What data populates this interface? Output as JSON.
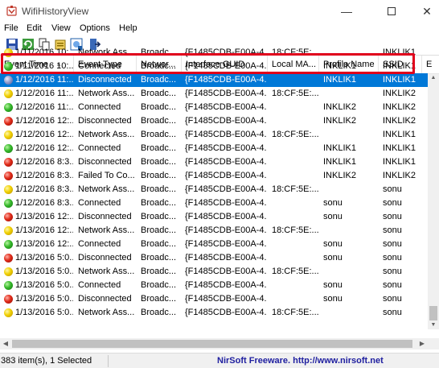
{
  "window": {
    "title": "WifiHistoryView"
  },
  "menu": [
    "File",
    "Edit",
    "View",
    "Options",
    "Help"
  ],
  "toolbar": [
    "save-icon",
    "refresh-icon",
    "copy-icon",
    "properties-icon",
    "html-report-icon",
    "exit-icon"
  ],
  "columns": [
    "Event Time",
    "Event Type",
    "Networ...",
    "Interface GUID",
    "Local MA...",
    "Profile Name",
    "SSID",
    "E"
  ],
  "rows": [
    {
      "status": "yellow",
      "time": "1/11/2016 10:...",
      "type": "Network Ass...",
      "network": "Broadc...",
      "guid": "{F1485CDB-E00A-4...",
      "mac": "18:CF:5E:...",
      "profile": "",
      "ssid": "INKLIK1"
    },
    {
      "status": "green",
      "time": "1/11/2016 10:...",
      "type": "Connected",
      "network": "Broadc...",
      "guid": "{F1485CDB-E00A-4...",
      "mac": "",
      "profile": "INKLIK1",
      "ssid": "INKLIK1"
    },
    {
      "status": "gray",
      "time": "1/12/2016 11:...",
      "type": "Disconnected",
      "network": "Broadc...",
      "guid": "{F1485CDB-E00A-4...",
      "mac": "",
      "profile": "INKLIK1",
      "ssid": "INKLIK1",
      "selected": true
    },
    {
      "status": "yellow",
      "time": "1/12/2016 11:...",
      "type": "Network Ass...",
      "network": "Broadc...",
      "guid": "{F1485CDB-E00A-4...",
      "mac": "18:CF:5E:...",
      "profile": "",
      "ssid": "INKLIK2"
    },
    {
      "status": "green",
      "time": "1/12/2016 11:...",
      "type": "Connected",
      "network": "Broadc...",
      "guid": "{F1485CDB-E00A-4...",
      "mac": "",
      "profile": "INKLIK2",
      "ssid": "INKLIK2"
    },
    {
      "status": "red",
      "time": "1/12/2016 12:...",
      "type": "Disconnected",
      "network": "Broadc...",
      "guid": "{F1485CDB-E00A-4...",
      "mac": "",
      "profile": "INKLIK2",
      "ssid": "INKLIK2"
    },
    {
      "status": "yellow",
      "time": "1/12/2016 12:...",
      "type": "Network Ass...",
      "network": "Broadc...",
      "guid": "{F1485CDB-E00A-4...",
      "mac": "18:CF:5E:...",
      "profile": "",
      "ssid": "INKLIK1"
    },
    {
      "status": "green",
      "time": "1/12/2016 12:...",
      "type": "Connected",
      "network": "Broadc...",
      "guid": "{F1485CDB-E00A-4...",
      "mac": "",
      "profile": "INKLIK1",
      "ssid": "INKLIK1"
    },
    {
      "status": "red",
      "time": "1/12/2016 8:3...",
      "type": "Disconnected",
      "network": "Broadc...",
      "guid": "{F1485CDB-E00A-4...",
      "mac": "",
      "profile": "INKLIK1",
      "ssid": "INKLIK1"
    },
    {
      "status": "red",
      "time": "1/12/2016 8:3...",
      "type": "Failed To Co...",
      "network": "Broadc...",
      "guid": "{F1485CDB-E00A-4...",
      "mac": "",
      "profile": "INKLIK2",
      "ssid": "INKLIK2"
    },
    {
      "status": "yellow",
      "time": "1/12/2016 8:3...",
      "type": "Network Ass...",
      "network": "Broadc...",
      "guid": "{F1485CDB-E00A-4...",
      "mac": "18:CF:5E:...",
      "profile": "",
      "ssid": "sonu"
    },
    {
      "status": "green",
      "time": "1/12/2016 8:3...",
      "type": "Connected",
      "network": "Broadc...",
      "guid": "{F1485CDB-E00A-4...",
      "mac": "",
      "profile": "sonu",
      "ssid": "sonu"
    },
    {
      "status": "red",
      "time": "1/13/2016 12:...",
      "type": "Disconnected",
      "network": "Broadc...",
      "guid": "{F1485CDB-E00A-4...",
      "mac": "",
      "profile": "sonu",
      "ssid": "sonu"
    },
    {
      "status": "yellow",
      "time": "1/13/2016 12:...",
      "type": "Network Ass...",
      "network": "Broadc...",
      "guid": "{F1485CDB-E00A-4...",
      "mac": "18:CF:5E:...",
      "profile": "",
      "ssid": "sonu"
    },
    {
      "status": "green",
      "time": "1/13/2016 12:...",
      "type": "Connected",
      "network": "Broadc...",
      "guid": "{F1485CDB-E00A-4...",
      "mac": "",
      "profile": "sonu",
      "ssid": "sonu"
    },
    {
      "status": "red",
      "time": "1/13/2016 5:0...",
      "type": "Disconnected",
      "network": "Broadc...",
      "guid": "{F1485CDB-E00A-4...",
      "mac": "",
      "profile": "sonu",
      "ssid": "sonu"
    },
    {
      "status": "yellow",
      "time": "1/13/2016 5:0...",
      "type": "Network Ass...",
      "network": "Broadc...",
      "guid": "{F1485CDB-E00A-4...",
      "mac": "18:CF:5E:...",
      "profile": "",
      "ssid": "sonu"
    },
    {
      "status": "green",
      "time": "1/13/2016 5:0...",
      "type": "Connected",
      "network": "Broadc...",
      "guid": "{F1485CDB-E00A-4...",
      "mac": "",
      "profile": "sonu",
      "ssid": "sonu"
    },
    {
      "status": "red",
      "time": "1/13/2016 5:0...",
      "type": "Disconnected",
      "network": "Broadc...",
      "guid": "{F1485CDB-E00A-4...",
      "mac": "",
      "profile": "sonu",
      "ssid": "sonu"
    },
    {
      "status": "yellow",
      "time": "1/13/2016 5:0...",
      "type": "Network Ass...",
      "network": "Broadc...",
      "guid": "{F1485CDB-E00A-4...",
      "mac": "18:CF:5E:...",
      "profile": "",
      "ssid": "sonu"
    }
  ],
  "status": {
    "count": "383 item(s), 1 Selected",
    "link": "NirSoft Freeware.  http://www.nirsoft.net"
  },
  "colors": {
    "selection": "#0078d7",
    "highlight_box": "#e0001b",
    "link": "#2020a0"
  }
}
